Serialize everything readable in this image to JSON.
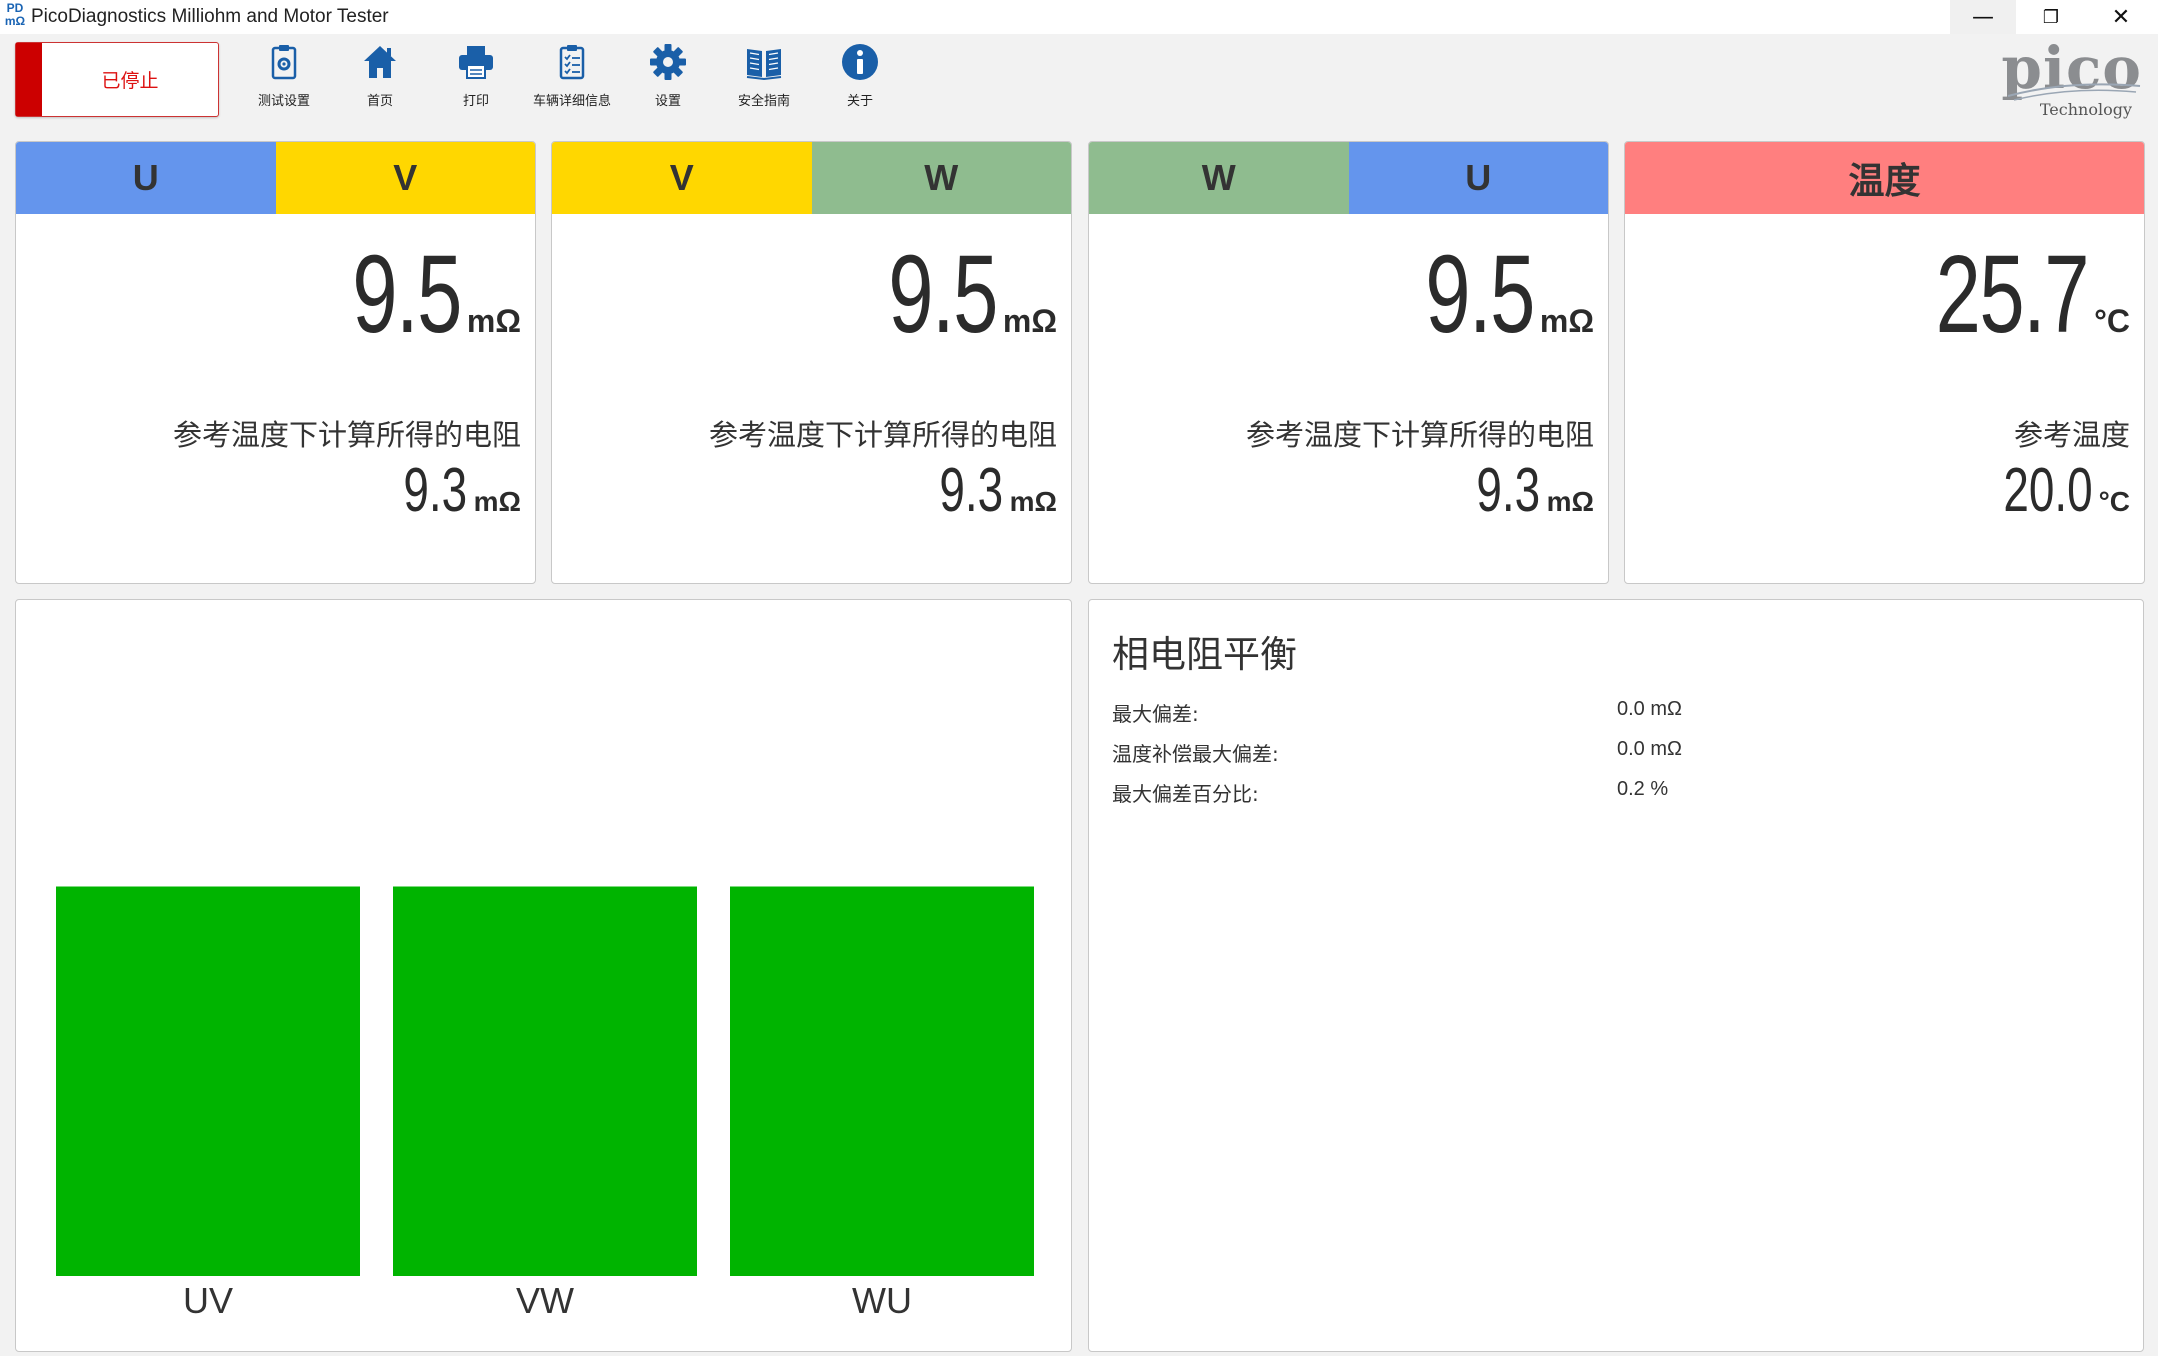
{
  "window": {
    "icon_text_top": "PD",
    "icon_text_bottom": "mΩ",
    "title": "PicoDiagnostics Milliohm and Motor Tester",
    "minimize": "—",
    "maximize": "❐",
    "close": "✕"
  },
  "toolbar": {
    "status_label": "已停止",
    "items": [
      {
        "label": "测试设置",
        "icon": "test-settings-icon"
      },
      {
        "label": "首页",
        "icon": "home-icon"
      },
      {
        "label": "打印",
        "icon": "printer-icon"
      },
      {
        "label": "车辆详细信息",
        "icon": "vehicle-details-icon"
      },
      {
        "label": "设置",
        "icon": "gear-icon"
      },
      {
        "label": "安全指南",
        "icon": "book-icon"
      },
      {
        "label": "关于",
        "icon": "info-icon"
      }
    ],
    "icon_color": "#1a5fa8"
  },
  "logo": {
    "word": "pico",
    "sub": "Technology"
  },
  "colors": {
    "U": "#6495ed",
    "V": "#ffd700",
    "W": "#8fbc8f",
    "temp": "#ff7f7f",
    "bar": "#00b400"
  },
  "cards": [
    {
      "left": "U",
      "right": "V",
      "value": "9.5",
      "unit": "mΩ",
      "ref_label": "参考温度下计算所得的电阻",
      "ref_value": "9.3",
      "ref_unit": "mΩ"
    },
    {
      "left": "V",
      "right": "W",
      "value": "9.5",
      "unit": "mΩ",
      "ref_label": "参考温度下计算所得的电阻",
      "ref_value": "9.3",
      "ref_unit": "mΩ"
    },
    {
      "left": "W",
      "right": "U",
      "value": "9.5",
      "unit": "mΩ",
      "ref_label": "参考温度下计算所得的电阻",
      "ref_value": "9.3",
      "ref_unit": "mΩ"
    }
  ],
  "temperature": {
    "label": "温度",
    "value": "25.7",
    "unit": "°C",
    "ref_label": "参考温度",
    "ref_value": "20.0",
    "ref_unit": "°C"
  },
  "balance": {
    "title": "相电阻平衡",
    "rows": [
      {
        "label": "最大偏差:",
        "value": "0.0 mΩ"
      },
      {
        "label": "温度补偿最大偏差:",
        "value": "0.0 mΩ"
      },
      {
        "label": "最大偏差百分比:",
        "value": "0.2 %"
      }
    ]
  },
  "chart_data": {
    "type": "bar",
    "categories": [
      "UV",
      "VW",
      "WU"
    ],
    "values": [
      9.5,
      9.5,
      9.5
    ],
    "title": "",
    "xlabel": "",
    "ylabel": "",
    "ylim": [
      0,
      16
    ]
  }
}
